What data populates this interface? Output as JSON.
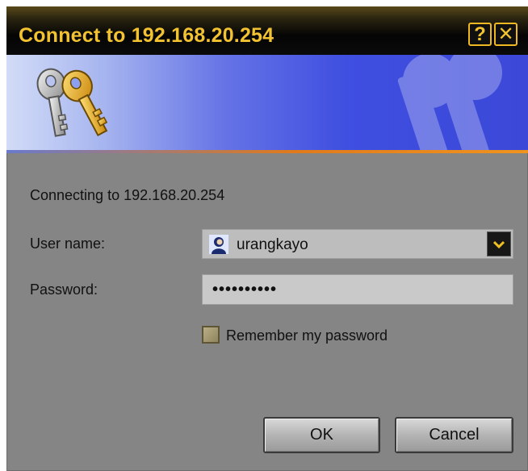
{
  "window": {
    "title": "Connect to 192.168.20.254",
    "help_label": "?",
    "close_label": "✕"
  },
  "banner": {
    "icon": "keys-icon",
    "watermark_icon": "keys-watermark-icon"
  },
  "form": {
    "connecting_text": "Connecting to 192.168.20.254",
    "username_label": "User name:",
    "username_value": "urangkayo",
    "username_icon": "user-icon",
    "password_label": "Password:",
    "password_value": "••••••••••",
    "remember_label": "Remember my password",
    "remember_checked": false
  },
  "buttons": {
    "ok_label": "OK",
    "cancel_label": "Cancel"
  },
  "colors": {
    "title_text": "#f2c230",
    "dialog_bg": "#858585",
    "banner_accent": "#3f4fe0",
    "divider_accent": "#f0941e"
  }
}
